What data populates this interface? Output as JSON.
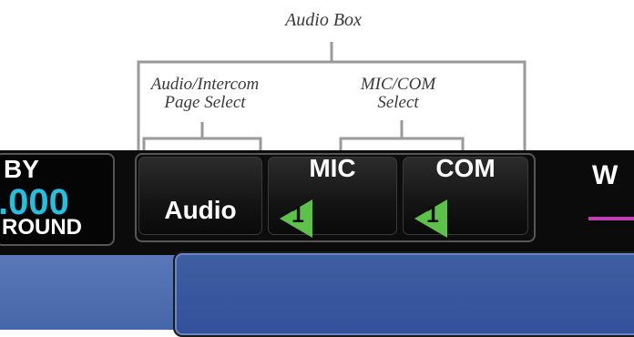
{
  "callouts": {
    "audio_box": "Audio Box",
    "audio_page_line1": "Audio/Intercom",
    "audio_page_line2": "Page Select",
    "mic_com_line1": "MIC/COM",
    "mic_com_line2": "Select"
  },
  "standby": {
    "label": "BY",
    "frequency": ".000",
    "sub_label": "ROUND"
  },
  "audio_panel": {
    "audio_key": "Audio",
    "mic_key": "MIC",
    "mic_indicator": "1",
    "com_key": "COM",
    "com_indicator": "1"
  },
  "right_window": {
    "label": "W"
  },
  "colors": {
    "indicator_green": "#5cc24a",
    "frequency_cyan": "#23c0e0",
    "magenta_line": "#c040b0",
    "bottom_blue": "#4566a8"
  }
}
